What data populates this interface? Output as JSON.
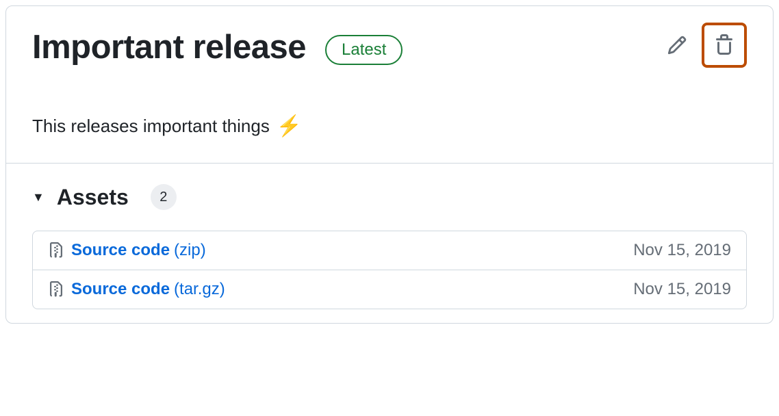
{
  "release": {
    "title": "Important release",
    "badge": "Latest",
    "description": "This releases important things",
    "emoji": "⚡"
  },
  "assets": {
    "heading": "Assets",
    "count": "2",
    "items": [
      {
        "name": "Source code",
        "ext": "(zip)",
        "date": "Nov 15, 2019"
      },
      {
        "name": "Source code",
        "ext": "(tar.gz)",
        "date": "Nov 15, 2019"
      }
    ]
  }
}
